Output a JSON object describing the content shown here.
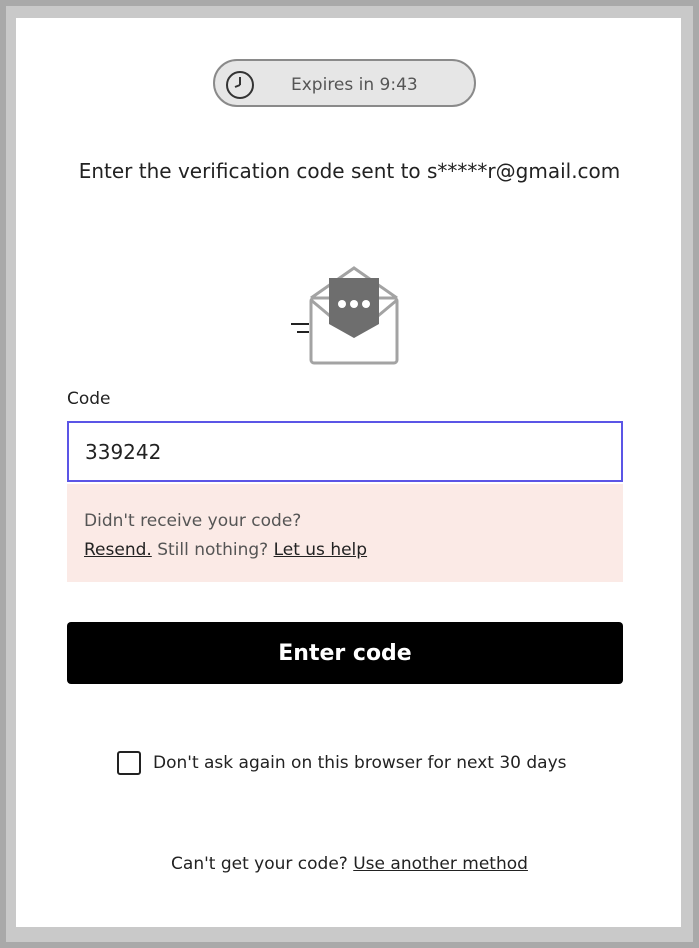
{
  "timer": {
    "icon": "clock-icon",
    "text": "Expires in 9:43"
  },
  "instruction": "Enter the verification code sent to s*****r@gmail.com",
  "illustration": {
    "icon": "envelope-message-icon"
  },
  "code_field": {
    "label": "Code",
    "value": "339242",
    "focus_color": "#5b55e6"
  },
  "help": {
    "line1": "Didn't receive your code?",
    "resend": "Resend.",
    "still_nothing": "Still nothing?",
    "help_link": "Let us help",
    "background": "#fbeae6"
  },
  "submit": {
    "label": "Enter code"
  },
  "remember": {
    "label": "Don't ask again on this browser for next 30 days",
    "checked": false
  },
  "footer": {
    "prompt": "Can't get your code?",
    "link": "Use another method"
  }
}
